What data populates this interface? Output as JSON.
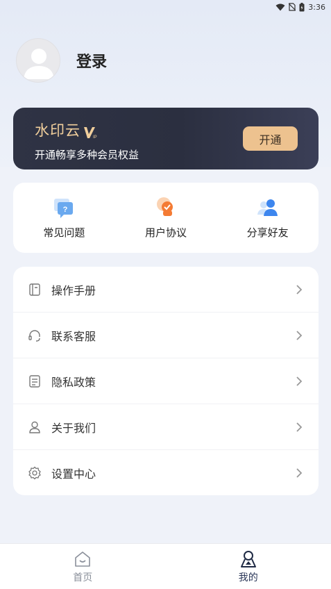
{
  "status_bar": {
    "time": "3:36",
    "icons": [
      "wifi-icon",
      "no-sim-icon",
      "battery-icon"
    ]
  },
  "profile": {
    "avatar_icon": "default-avatar-icon",
    "login_label": "登录"
  },
  "vip_card": {
    "title": "水印云",
    "badge_icon": "vip-badge-icon",
    "badge_text": "VIP",
    "subtitle": "开通畅享多种会员权益",
    "button_label": "开通",
    "accent_color": "#edc28f"
  },
  "quick_actions": [
    {
      "label": "常见问题",
      "icon": "faq-chat-icon"
    },
    {
      "label": "用户协议",
      "icon": "user-agreement-icon"
    },
    {
      "label": "分享好友",
      "icon": "share-friends-icon"
    }
  ],
  "menu": [
    {
      "label": "操作手册",
      "icon": "manual-icon"
    },
    {
      "label": "联系客服",
      "icon": "headset-icon"
    },
    {
      "label": "隐私政策",
      "icon": "document-icon"
    },
    {
      "label": "关于我们",
      "icon": "user-icon"
    },
    {
      "label": "设置中心",
      "icon": "gear-icon"
    }
  ],
  "bottom_nav": [
    {
      "label": "首页",
      "icon": "home-icon",
      "active": false
    },
    {
      "label": "我的",
      "icon": "profile-compass-icon",
      "active": true
    }
  ]
}
